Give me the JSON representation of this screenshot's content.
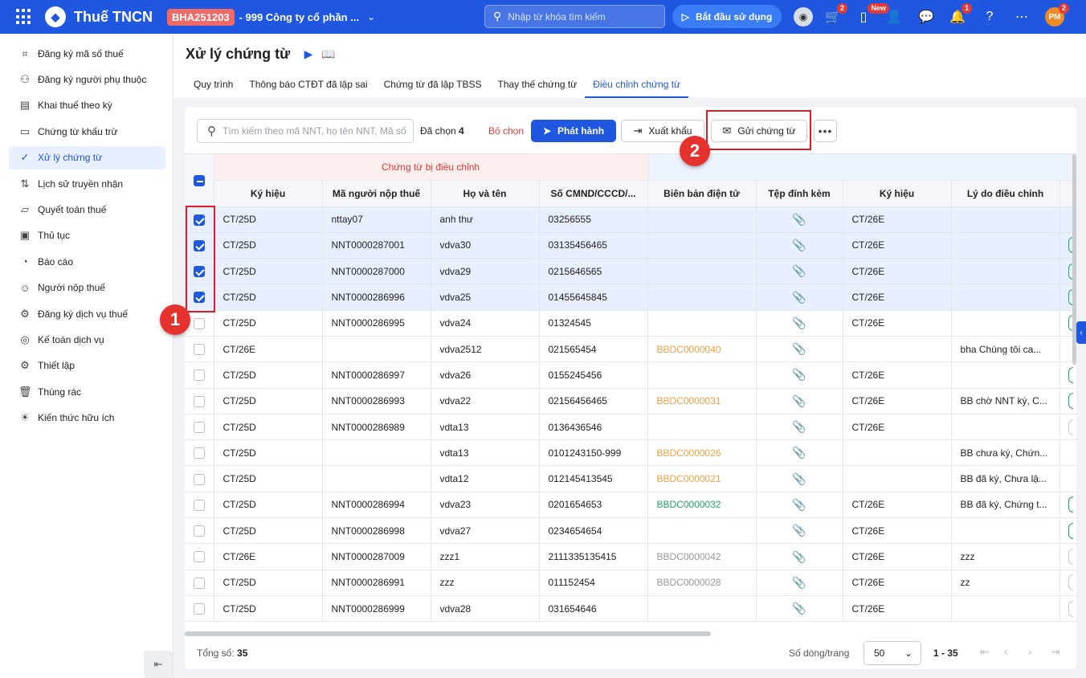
{
  "topbar": {
    "app_title": "Thuế TNCN",
    "tenant_code": "BHA251203",
    "company": "- 999 Công ty cổ phần ...",
    "search_placeholder": "Nhập từ khóa tìm kiếm",
    "start_button": "Bắt đầu sử dụng",
    "cart_badge": "2",
    "mobile_badge": "New",
    "bell_badge": "1",
    "avatar_initials": "PM",
    "avatar_badge": "2"
  },
  "sidebar": {
    "items": [
      {
        "label": "Đăng ký mã số thuế",
        "icon": "id-scan-icon"
      },
      {
        "label": "Đăng ký người phụ thuộc",
        "icon": "people-icon"
      },
      {
        "label": "Khai thuế theo kỳ",
        "icon": "document-icon"
      },
      {
        "label": "Chứng từ khấu trừ",
        "icon": "receipt-icon"
      },
      {
        "label": "Xử lý chứng từ",
        "icon": "doc-check-icon"
      },
      {
        "label": "Lịch sử truyền nhận",
        "icon": "transfer-icon"
      },
      {
        "label": "Quyết toán thuế",
        "icon": "folder-icon"
      },
      {
        "label": "Thủ tục",
        "icon": "clipboard-icon"
      },
      {
        "label": "Báo cáo",
        "icon": "pie-chart-icon"
      },
      {
        "label": "Người nộp thuế",
        "icon": "person-card-icon"
      },
      {
        "label": "Đăng ký dịch vụ thuế",
        "icon": "service-icon"
      },
      {
        "label": "Kế toán dịch vụ",
        "icon": "compass-icon"
      },
      {
        "label": "Thiết lập",
        "icon": "gear-icon"
      },
      {
        "label": "Thùng rác",
        "icon": "trash-icon"
      },
      {
        "label": "Kiến thức hữu ích",
        "icon": "lightbulb-icon"
      }
    ],
    "active_index": 4
  },
  "page": {
    "title": "Xử lý chứng từ",
    "tabs": [
      "Quy trình",
      "Thông báo CTĐT đã lập sai",
      "Chứng từ đã lập TBSS",
      "Thay thế chứng từ",
      "Điều chỉnh chứng từ"
    ],
    "active_tab": 4
  },
  "toolbar": {
    "search_placeholder": "Tìm kiếm theo mã NNT, họ tên NNT, Mã số",
    "selected_label": "Đã chọn",
    "selected_count": "4",
    "unselect_label": "Bỏ chọn",
    "publish_label": "Phát hành",
    "export_label": "Xuất khẩu",
    "send_label": "Gửi chứng từ"
  },
  "annotations": {
    "step1": "1",
    "step2": "2"
  },
  "table": {
    "group_headers": {
      "adjusted": "Chứng từ bị điều chỉnh",
      "adjusting": ""
    },
    "columns": [
      "Ký hiệu",
      "Mã người nộp thuế",
      "Họ và tên",
      "Số CMND/CCCD/...",
      "Biên bản điện tử",
      "Tệp đính kèm",
      "Ký hiệu",
      "Lý do điều chỉnh"
    ],
    "rows": [
      {
        "checked": true,
        "kh": "CT/25D",
        "mnnt": "nttay07",
        "name": "anh thư",
        "cmnd": "03256555",
        "bb": "",
        "bb_color": "",
        "kh2": "CT/26E",
        "reason": "",
        "pill": ""
      },
      {
        "checked": true,
        "kh": "CT/25D",
        "mnnt": "NNT0000287001",
        "name": "vdva30",
        "cmnd": "03135456465",
        "bb": "",
        "bb_color": "",
        "kh2": "CT/26E",
        "reason": "",
        "pill": "green"
      },
      {
        "checked": true,
        "kh": "CT/25D",
        "mnnt": "NNT0000287000",
        "name": "vdva29",
        "cmnd": "0215646565",
        "bb": "",
        "bb_color": "",
        "kh2": "CT/26E",
        "reason": "",
        "pill": "green"
      },
      {
        "checked": true,
        "kh": "CT/25D",
        "mnnt": "NNT0000286996",
        "name": "vdva25",
        "cmnd": "01455645845",
        "bb": "",
        "bb_color": "",
        "kh2": "CT/26E",
        "reason": "",
        "pill": "green"
      },
      {
        "checked": false,
        "kh": "CT/25D",
        "mnnt": "NNT0000286995",
        "name": "vdva24",
        "cmnd": "01324545",
        "bb": "",
        "bb_color": "",
        "kh2": "CT/26E",
        "reason": "",
        "pill": "green"
      },
      {
        "checked": false,
        "kh": "CT/26E",
        "mnnt": "",
        "name": "vdva2512",
        "cmnd": "021565454",
        "bb": "BBDC0000040",
        "bb_color": "orange",
        "kh2": "",
        "reason": "bha Chúng tôi ca...",
        "pill": ""
      },
      {
        "checked": false,
        "kh": "CT/25D",
        "mnnt": "NNT0000286997",
        "name": "vdva26",
        "cmnd": "0155245456",
        "bb": "",
        "bb_color": "",
        "kh2": "CT/26E",
        "reason": "",
        "pill": "green"
      },
      {
        "checked": false,
        "kh": "CT/25D",
        "mnnt": "NNT0000286993",
        "name": "vdva22",
        "cmnd": "02156456465",
        "bb": "BBDC0000031",
        "bb_color": "orange",
        "kh2": "CT/26E",
        "reason": "BB chờ NNT ký, C...",
        "pill": "green"
      },
      {
        "checked": false,
        "kh": "CT/25D",
        "mnnt": "NNT0000286989",
        "name": "vdta13",
        "cmnd": "0136436546",
        "bb": "",
        "bb_color": "",
        "kh2": "CT/26E",
        "reason": "",
        "pill": "gray"
      },
      {
        "checked": false,
        "kh": "CT/25D",
        "mnnt": "",
        "name": "vdta13",
        "cmnd": "0101243150-999",
        "bb": "BBDC0000026",
        "bb_color": "orange",
        "kh2": "",
        "reason": "BB chưa ký, Chứn...",
        "pill": ""
      },
      {
        "checked": false,
        "kh": "CT/25D",
        "mnnt": "",
        "name": "vdta12",
        "cmnd": "012145413545",
        "bb": "BBDC0000021",
        "bb_color": "orange",
        "kh2": "",
        "reason": "BB đã ký, Chưa lậ...",
        "pill": ""
      },
      {
        "checked": false,
        "kh": "CT/25D",
        "mnnt": "NNT0000286994",
        "name": "vdva23",
        "cmnd": "0201654653",
        "bb": "BBDC0000032",
        "bb_color": "green",
        "kh2": "CT/26E",
        "reason": "BB đã ký, Chứng t...",
        "pill": "green"
      },
      {
        "checked": false,
        "kh": "CT/25D",
        "mnnt": "NNT0000286998",
        "name": "vdva27",
        "cmnd": "0234654654",
        "bb": "",
        "bb_color": "",
        "kh2": "CT/26E",
        "reason": "",
        "pill": "green"
      },
      {
        "checked": false,
        "kh": "CT/26E",
        "mnnt": "NNT0000287009",
        "name": "zzz1",
        "cmnd": "2111335135415",
        "bb": "BBDC0000042",
        "bb_color": "gray",
        "kh2": "CT/26E",
        "reason": "zzz",
        "pill": "gray"
      },
      {
        "checked": false,
        "kh": "CT/25D",
        "mnnt": "NNT0000286991",
        "name": "zzz",
        "cmnd": "011152454",
        "bb": "BBDC0000028",
        "bb_color": "gray",
        "kh2": "CT/26E",
        "reason": "zz",
        "pill": "gray"
      },
      {
        "checked": false,
        "kh": "CT/25D",
        "mnnt": "NNT0000286999",
        "name": "vdva28",
        "cmnd": "031654646",
        "bb": "",
        "bb_color": "",
        "kh2": "CT/26E",
        "reason": "",
        "pill": "gray"
      }
    ]
  },
  "footer": {
    "total_label": "Tổng số:",
    "total": "35",
    "rows_per_page_label": "Số dòng/trang",
    "rows_per_page": "50",
    "range": "1 - 35"
  }
}
